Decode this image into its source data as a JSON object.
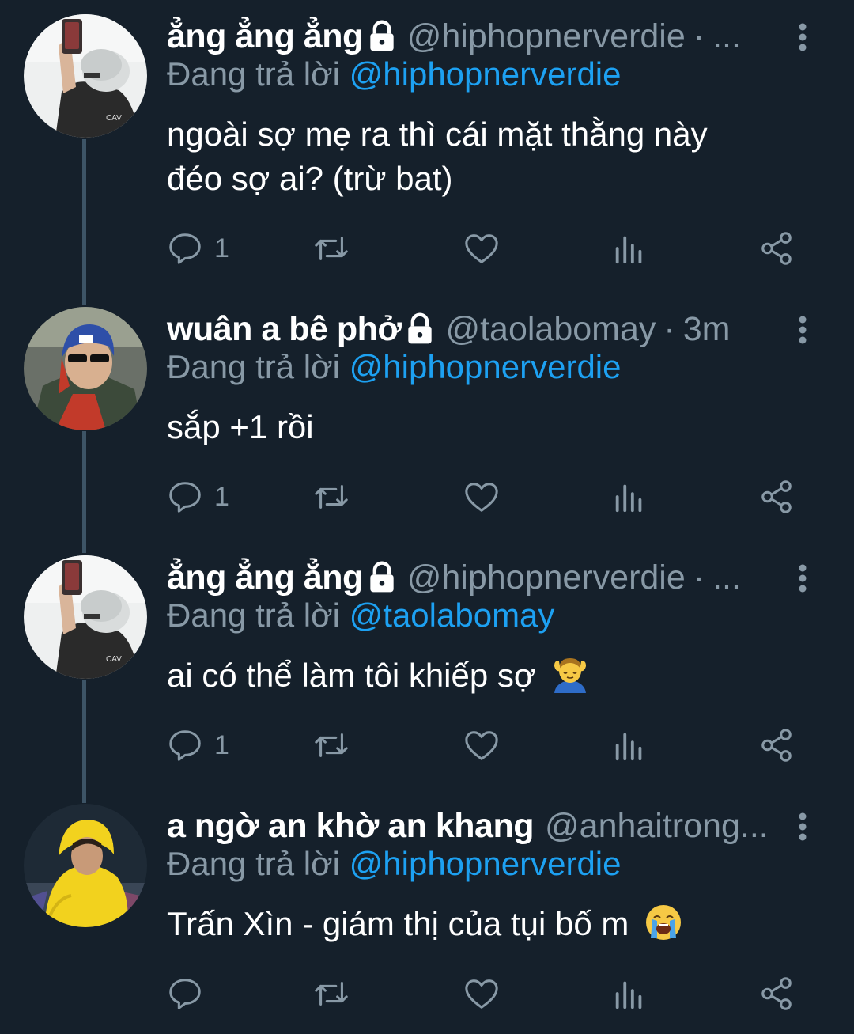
{
  "colors": {
    "background": "#15202b",
    "text_primary": "#ffffff",
    "text_secondary": "#8899a6",
    "link": "#1da1f2",
    "thread_line": "#3d5466"
  },
  "tweets": [
    {
      "display_name": "ẳng ẳng ẳng",
      "handle": "@hiphopnerverdie",
      "dot": "·",
      "time": "...",
      "protected_icon": "lock-icon",
      "reply_prefix": "Đang trả lời",
      "reply_mention": "@hiphopnerverdie",
      "text_lines": [
        "ngoài sợ mẹ ra thì cái mặt thằng này",
        "đéo sợ ai? (trừ bat)"
      ],
      "emoji": "",
      "reply_count": "1",
      "avatar": "avatar-white-hair-phone"
    },
    {
      "display_name": "wuân a bê phở",
      "handle": "@taolabomay",
      "dot": "·",
      "time": "3m",
      "protected_icon": "lock-icon",
      "reply_prefix": "Đang trả lời",
      "reply_mention": "@hiphopnerverdie",
      "text_lines": [
        "sắp +1 rồi"
      ],
      "emoji": "",
      "reply_count": "1",
      "avatar": "avatar-red-hood-sunglasses"
    },
    {
      "display_name": "ẳng ẳng ẳng",
      "handle": "@hiphopnerverdie",
      "dot": "·",
      "time": "...",
      "protected_icon": "lock-icon",
      "reply_prefix": "Đang trả lời",
      "reply_mention": "@taolabomay",
      "text_lines": [
        "ai có thể làm tôi khiếp sợ"
      ],
      "emoji": "massage-emoji",
      "reply_count": "1",
      "avatar": "avatar-white-hair-phone"
    },
    {
      "display_name": "a ngờ an khờ an khang",
      "handle": "@anhaitrong...",
      "dot": "",
      "time": "",
      "protected_icon": "",
      "reply_prefix": "Đang trả lời",
      "reply_mention": "@hiphopnerverdie",
      "text_lines": [
        "Trấn Xìn - giám thị của tụi bố m"
      ],
      "emoji": "loudly-crying-emoji",
      "reply_count": "",
      "avatar": "avatar-yellow-jacket"
    }
  ],
  "action_icons": [
    "reply-icon",
    "retweet-icon",
    "like-icon",
    "analytics-icon",
    "share-icon"
  ]
}
